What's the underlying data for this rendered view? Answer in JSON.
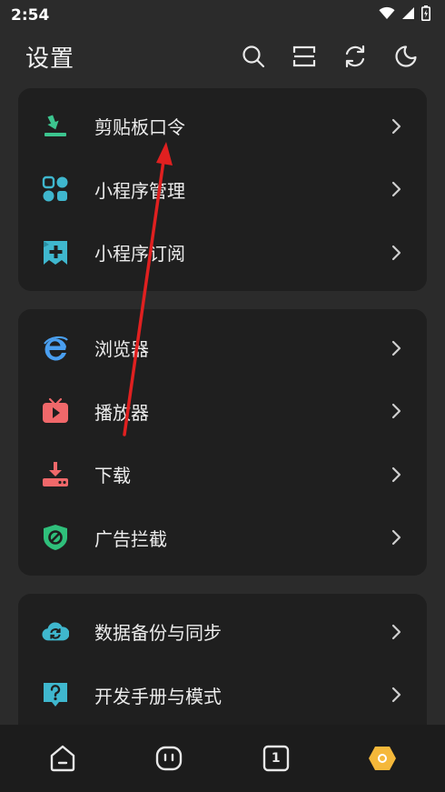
{
  "status_bar": {
    "time": "2:54",
    "icons": [
      "wifi-icon",
      "signal-icon",
      "battery-icon"
    ]
  },
  "header": {
    "title": "设置",
    "actions": [
      "search-icon",
      "scan-icon",
      "sync-icon",
      "night-mode-icon"
    ]
  },
  "groups": [
    {
      "items": [
        {
          "label": "剪贴板口令",
          "icon": "clipboard-download-icon",
          "color": "#3cc58f"
        },
        {
          "label": "小程序管理",
          "icon": "apps-grid-icon",
          "color": "#3fb7ce"
        },
        {
          "label": "小程序订阅",
          "icon": "bookmark-add-icon",
          "color": "#3fb7ce"
        }
      ]
    },
    {
      "items": [
        {
          "label": "浏览器",
          "icon": "browser-e-icon",
          "color": "#4a9ff0"
        },
        {
          "label": "播放器",
          "icon": "tv-play-icon",
          "color": "#f0686a"
        },
        {
          "label": "下载",
          "icon": "download-icon",
          "color": "#f0686a"
        },
        {
          "label": "广告拦截",
          "icon": "ad-block-shield-icon",
          "color": "#2fbf7b"
        }
      ]
    },
    {
      "items": [
        {
          "label": "数据备份与同步",
          "icon": "cloud-sync-icon",
          "color": "#3fb7ce"
        },
        {
          "label": "开发手册与模式",
          "icon": "help-chat-icon",
          "color": "#3fb7ce"
        }
      ]
    }
  ],
  "bottom_nav": [
    "home-icon",
    "bot-icon",
    "tab-count-icon",
    "profile-hex-icon"
  ],
  "tab_count": "1",
  "colors": {
    "background": "#2b2b2b",
    "card": "#1f1f1f",
    "accent_yellow": "#f5b83a",
    "annotation_red": "#e02020"
  }
}
